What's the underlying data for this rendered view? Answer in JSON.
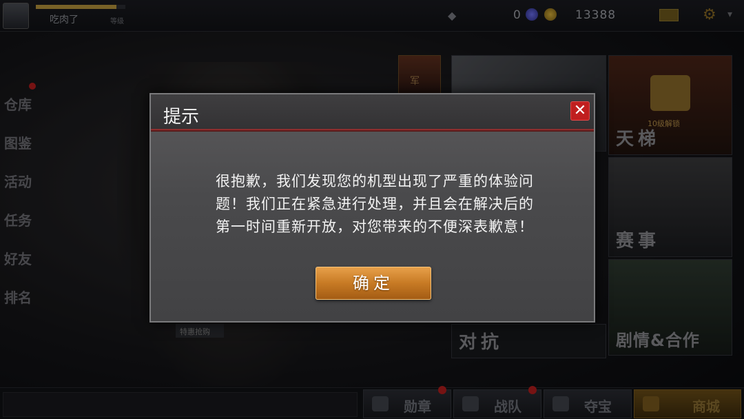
{
  "topbar": {
    "player_name": "吃肉了",
    "player_level": "等级",
    "xp_progress": 0.9,
    "gem_count": "0",
    "coin_count": "13388"
  },
  "left_menu": [
    {
      "label": "仓库",
      "badge": true
    },
    {
      "label": "图鉴",
      "badge": false
    },
    {
      "label": "活动",
      "badge": false
    },
    {
      "label": "任务",
      "badge": false
    },
    {
      "label": "好友",
      "badge": false
    },
    {
      "label": "排名",
      "badge": false
    }
  ],
  "modes": {
    "ladder": "天梯",
    "ladder_lock_text": "10级解锁",
    "event": "赛事",
    "versus": "对抗",
    "story": "剧情&合作",
    "rank_emblem": "军",
    "sale_tag": "特惠抢购"
  },
  "bottom_nav": {
    "items": [
      {
        "label": "勋章",
        "badge": true
      },
      {
        "label": "战队",
        "badge": true
      },
      {
        "label": "夺宝",
        "badge": false
      },
      {
        "label": "商城",
        "badge": false
      }
    ]
  },
  "dialog": {
    "title": "提示",
    "close_symbol": "✕",
    "message_lines": [
      "很抱歉，我们发现您的机型出现了严重的体验问",
      "题！我们正在紧急进行处理，并且会在解决后的",
      "第一时间重新开放，对您带来的不便深表歉意！"
    ],
    "confirm_label": "确定"
  },
  "colors": {
    "accent_red": "#c01f1f",
    "button_orange": "#c77a24",
    "dialog_gray": "#4a4a4c"
  }
}
